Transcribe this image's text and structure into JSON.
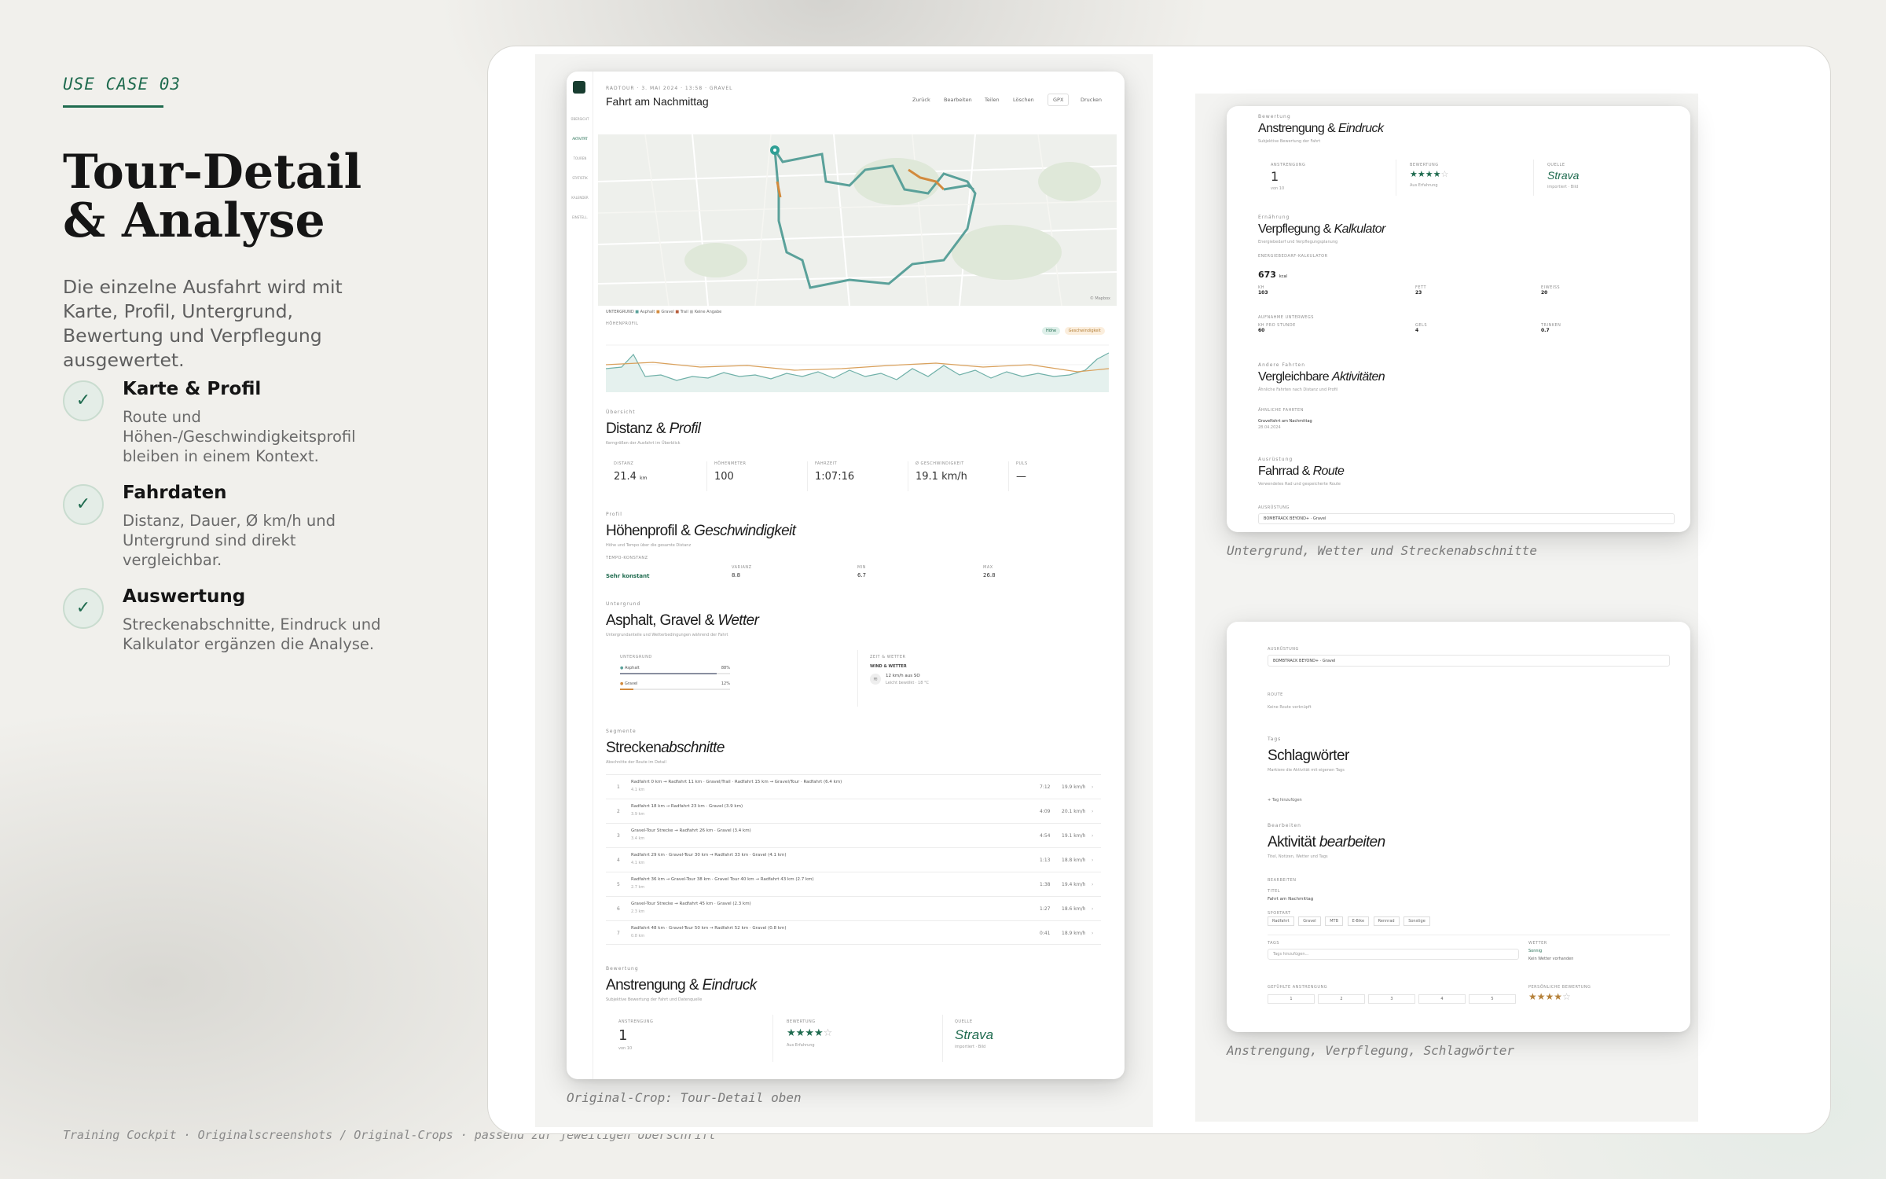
{
  "left": {
    "eyebrow": "USE CASE 03",
    "headline_line1": "Tour-Detail",
    "headline_line2": "& Analyse",
    "lead": "Die einzelne Ausfahrt wird mit Karte, Profil, Untergrund, Bewertung und Verpflegung ausgewertet.",
    "features": [
      {
        "title": "Karte & Profil",
        "desc": "Route und Höhen-/Geschwindigkeitsprofil bleiben in einem Kontext."
      },
      {
        "title": "Fahrdaten",
        "desc": "Distanz, Dauer, Ø km/h und Untergrund sind direkt vergleichbar."
      },
      {
        "title": "Auswertung",
        "desc": "Streckenabschnitte, Eindruck und Kalkulator ergänzen die Analyse."
      }
    ]
  },
  "footer": "Training Cockpit · Originalscreenshots / Original-Crops · passend zur jeweiligen Überschrift",
  "captions": {
    "main": "Original-Crop: Tour-Detail oben",
    "top_right": "Untergrund, Wetter und Streckenabschnitte",
    "bottom_right": "Anstrengung, Verpflegung, Schlagwörter"
  },
  "main_shot": {
    "meta": "RADTOUR · 3. MAI 2024 · 13:58 · GRAVEL",
    "title": "Fahrt am Nachmittag",
    "toolbar": [
      "Zurück",
      "Bearbeiten",
      "Teilen",
      "Löschen",
      "GPX",
      "Drucken"
    ],
    "sidebar": [
      "ÜBERSICHT",
      "AKTIVITÄT",
      "TOUREN",
      "STATISTIK",
      "KALENDER",
      "EINSTELL."
    ],
    "map_legend": [
      "UNTERGRUND",
      "Asphalt",
      "Gravel",
      "Trail",
      "Keine Angabe"
    ],
    "map_attribution": "© Mapbox",
    "profile_label": "HÖHENPROFIL",
    "profile_chips": [
      "Höhe",
      "Geschwindigkeit"
    ],
    "section_distance": {
      "eyebrow": "Übersicht",
      "title": "Distanz & ",
      "title_em": "Profil",
      "sub": "Kerngrößen der Ausfahrt im Überblick",
      "stats": [
        {
          "label": "DISTANZ",
          "value": "21.4",
          "unit": "km"
        },
        {
          "label": "HÖHENMETER",
          "value": "100",
          "unit": ""
        },
        {
          "label": "FAHRZEIT",
          "value": "1:07:16",
          "unit": ""
        },
        {
          "label": "Ø GESCHWINDIGKEIT",
          "value": "19.1 km/h",
          "unit": ""
        },
        {
          "label": "PULS",
          "value": "—",
          "unit": ""
        }
      ]
    },
    "section_profile": {
      "eyebrow": "Profil",
      "title": "Höhenprofil & ",
      "title_em": "Geschwindigkeit",
      "sub": "Höhe und Tempo über die gesamte Distanz",
      "tempo_label": "TEMPO-KONSTANZ",
      "tempo_value": "Sehr konstant",
      "mini": [
        {
          "label": "VARIANZ",
          "value": "8.8"
        },
        {
          "label": "MIN",
          "value": "6.7"
        },
        {
          "label": "MAX",
          "value": "26.8"
        }
      ]
    },
    "section_surface": {
      "eyebrow": "Untergrund",
      "title": "Asphalt, Gravel & ",
      "title_em": "Wetter",
      "sub": "Untergrundanteile und Wetterbedingungen während der Fahrt",
      "surface_label": "UNTERGRUND",
      "surfaces": [
        {
          "name": "Asphalt",
          "pct": "88%",
          "share": 0.88
        },
        {
          "name": "Gravel",
          "pct": "12%",
          "share": 0.12
        }
      ],
      "weather_label": "ZEIT & WETTER",
      "weather_title": "WIND & WETTER",
      "weather_text": "12 km/h aus SO",
      "weather_sub": "Leicht bewölkt · 18 °C"
    },
    "section_segments": {
      "eyebrow": "Segmente",
      "title": "Strecken",
      "title_em": "abschnitte",
      "sub": "Abschnitte der Route im Detail",
      "rows": [
        {
          "n": "1",
          "d": "Radfahrt 0 km → Radfahrt 11 km · Gravel/Trail · Radfahrt 15 km → Gravel/Tour · Radfahrt (6.4 km)",
          "dd": "4.1 km",
          "tm": "7:12",
          "sp": "19.9 km/h"
        },
        {
          "n": "2",
          "d": "Radfahrt 18 km → Radfahrt 23 km · Gravel (3.9 km)",
          "dd": "3.9 km",
          "tm": "4:09",
          "sp": "20.1 km/h"
        },
        {
          "n": "3",
          "d": "Gravel-Tour Strecke → Radfahrt 26 km · Gravel (3.4 km)",
          "dd": "3.4 km",
          "tm": "4:54",
          "sp": "19.1 km/h"
        },
        {
          "n": "4",
          "d": "Radfahrt 29 km · Gravel-Tour 30 km → Radfahrt 33 km · Gravel (4.1 km)",
          "dd": "4.1 km",
          "tm": "1:13",
          "sp": "18.8 km/h"
        },
        {
          "n": "5",
          "d": "Radfahrt 36 km → Gravel-Tour 38 km · Gravel Tour 40 km → Radfahrt 43 km (2.7 km)",
          "dd": "2.7 km",
          "tm": "1:38",
          "sp": "19.4 km/h"
        },
        {
          "n": "6",
          "d": "Gravel-Tour Strecke → Radfahrt 45 km · Gravel (2.3 km)",
          "dd": "2.3 km",
          "tm": "1:27",
          "sp": "18.6 km/h"
        },
        {
          "n": "7",
          "d": "Radfahrt 48 km · Gravel-Tour 50 km → Radfahrt 52 km · Gravel (0.8 km)",
          "dd": "0.8 km",
          "tm": "0:41",
          "sp": "18.9 km/h"
        }
      ]
    },
    "section_effort": {
      "eyebrow": "Bewertung",
      "title": "Anstrengung & ",
      "title_em": "Eindruck",
      "sub": "Subjektive Bewertung der Fahrt und Datenquelle",
      "effort_label": "ANSTRENGUNG",
      "effort_value": "1",
      "effort_sub": "von 10",
      "rating_label": "BEWERTUNG",
      "rating": 4,
      "rating_sub": "Aus Erfahrung",
      "source_label": "QUELLE",
      "source_value": "Strava",
      "source_sub": "importiert · Bild"
    }
  },
  "tr_shot": {
    "effort": {
      "eyebrow": "Bewertung",
      "title": "Anstrengung & ",
      "title_em": "Eindruck",
      "sub": "Subjektive Bewertung der Fahrt",
      "effort_label": "ANSTRENGUNG",
      "effort_value": "1",
      "effort_sub": "von 10",
      "rating_label": "BEWERTUNG",
      "rating": 4,
      "rating_sub": "Aus Erfahrung",
      "source_label": "QUELLE",
      "source_value": "Strava",
      "source_sub": "importiert · Bild"
    },
    "nutrition": {
      "eyebrow": "Ernährung",
      "title": "Verpflegung & ",
      "title_em": "Kalkulator",
      "sub": "Energiebedarf und Verpflegungsplanung",
      "calc_label": "ENERGIEBEDARF-KALKULATOR",
      "kcal": "673",
      "kcal_unit": "kcal",
      "rows": [
        {
          "label": "KH",
          "value": "103"
        },
        {
          "label": "FETT",
          "value": "23"
        },
        {
          "label": "EIWEISS",
          "value": "20"
        }
      ],
      "intake_label": "AUFNAHME UNTERWEGS",
      "intake": [
        {
          "label": "KH PRO STUNDE",
          "value": "60"
        },
        {
          "label": "GELS",
          "value": "4"
        },
        {
          "label": "TRINKEN",
          "value": "0.7"
        }
      ]
    },
    "compare": {
      "eyebrow": "Andere Fahrten",
      "title": "Vergleichbare ",
      "title_em": "Aktivitäten",
      "sub": "Ähnliche Fahrten nach Distanz und Profil",
      "list_label": "ÄHNLICHE FAHRTEN",
      "item": "Gravelfahrt am Nachmittag",
      "item_sub": "28.04.2024"
    },
    "bike": {
      "eyebrow": "Ausrüstung",
      "title": "Fahrrad & ",
      "title_em": "Route",
      "sub": "Verwendetes Rad und gespeicherte Route",
      "field_label": "AUSRÜSTUNG",
      "field_value": "BOMBTRACK BEYOND+ · Gravel"
    }
  },
  "br_shot": {
    "field_label": "AUSRÜSTUNG",
    "field_value": "BOMBTRACK BEYOND+ · Gravel",
    "route_label": "ROUTE",
    "route_value": "Keine Route verknüpft",
    "tags": {
      "eyebrow": "Tags",
      "title": "Schlagwörter",
      "sub": "Markiere die Aktivität mit eigenen Tags",
      "add": "+ Tag hinzufügen"
    },
    "edit": {
      "eyebrow": "Bearbeiten",
      "title": "Aktivität ",
      "title_em": "bearbeiten",
      "sub": "Titel, Notizen, Wetter und Tags",
      "section_label": "BEARBEITEN",
      "title_label": "TITEL",
      "title_value": "Fahrt am Nachmittag",
      "sport_label": "SPORTART",
      "sports": [
        "Radfahrt",
        "Gravel",
        "MTB",
        "E-Bike",
        "Rennrad",
        "Sonstige"
      ],
      "tags_label": "TAGS",
      "tags_placeholder": "Tags hinzufügen...",
      "wetter_label": "WETTER",
      "wetter_value": "Sonnig",
      "wetter_sub": "Kein Wetter vorhanden",
      "effort_label": "GEFÜHLTE ANSTRENGUNG",
      "effort_scale": [
        "1",
        "2",
        "3",
        "4",
        "5"
      ],
      "rating_label": "PERSÖNLICHE BEWERTUNG",
      "rating": 4
    }
  }
}
